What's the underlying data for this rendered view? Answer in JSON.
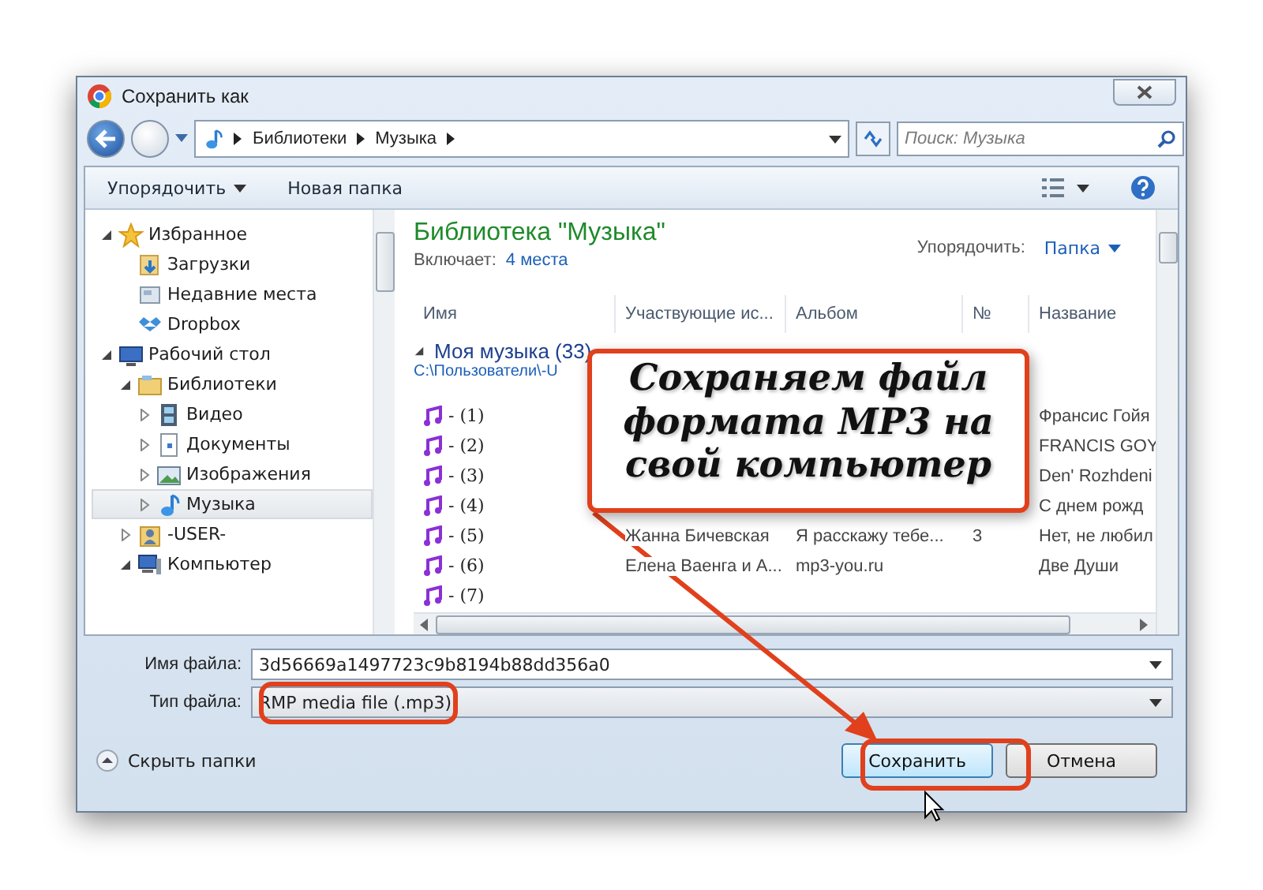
{
  "window": {
    "title": "Сохранить как"
  },
  "address_bar": {
    "crumbs": [
      "Библиотеки",
      "Музыка"
    ]
  },
  "search": {
    "placeholder": "Поиск: Музыка"
  },
  "toolbar": {
    "organize": "Упорядочить",
    "new_folder": "Новая папка"
  },
  "sidebar": {
    "items": [
      {
        "label": "Избранное",
        "kind": "favorites",
        "expanded": true,
        "selected": false,
        "children": [
          {
            "label": "Загрузки",
            "kind": "downloads",
            "selected": false
          },
          {
            "label": "Недавние места",
            "kind": "recent",
            "selected": false
          },
          {
            "label": "Dropbox",
            "kind": "dropbox",
            "selected": false
          }
        ]
      },
      {
        "label": "Рабочий стол",
        "kind": "desktop",
        "expanded": true,
        "selected": false,
        "children": [
          {
            "label": "Библиотеки",
            "kind": "libraries",
            "expanded": true,
            "selected": false,
            "children": [
              {
                "label": "Видео",
                "kind": "video",
                "expanded": false,
                "selected": false
              },
              {
                "label": "Документы",
                "kind": "documents",
                "expanded": false,
                "selected": false
              },
              {
                "label": "Изображения",
                "kind": "pictures",
                "expanded": false,
                "selected": false
              },
              {
                "label": "Музыка",
                "kind": "music",
                "expanded": false,
                "selected": true
              }
            ]
          },
          {
            "label": "-USER-",
            "kind": "user",
            "expanded": false,
            "selected": false
          },
          {
            "label": "Компьютер",
            "kind": "computer",
            "expanded": true,
            "selected": false
          }
        ]
      }
    ]
  },
  "library": {
    "title": "Библиотека \"Музыка\"",
    "includes_label": "Включает:",
    "includes_link": "4 места",
    "arrange_label": "Упорядочить:",
    "arrange_value": "Папка"
  },
  "table": {
    "columns": [
      "Имя",
      "Участвующие ис...",
      "Альбом",
      "№",
      "Название"
    ],
    "group": {
      "title": "Моя музыка (33)",
      "path": "C:\\Пользователи\\-U"
    },
    "rows": [
      {
        "name": "- (1)",
        "title": "Франсис Гойя"
      },
      {
        "name": "- (2)",
        "title": "FRANCIS GOY"
      },
      {
        "name": "- (3)",
        "title": "Den' Rozhdeni"
      },
      {
        "name": "- (4)",
        "title": "С днем рожд"
      },
      {
        "name": "- (5)",
        "artist": "Жанна Бичевская",
        "album": "Я расскажу тебе...",
        "number": "3",
        "title": "Нет, не любил"
      },
      {
        "name": "- (6)",
        "artist": "Елена Ваенга и А...",
        "album": "mp3-you.ru",
        "title": "Две Души"
      },
      {
        "name": "- (7)"
      }
    ]
  },
  "file_name": {
    "label": "Имя файла:",
    "value": "3d56669a1497723c9b8194b88dd356a0"
  },
  "file_type": {
    "label": "Тип файла:",
    "value": "RMP media file (.mp3)"
  },
  "hide_folders": "Скрыть папки",
  "buttons": {
    "save": "Сохранить",
    "cancel": "Отмена"
  },
  "callout": {
    "text": "Сохраняем файл\nформата MP3  на\nсвой компьютер"
  }
}
